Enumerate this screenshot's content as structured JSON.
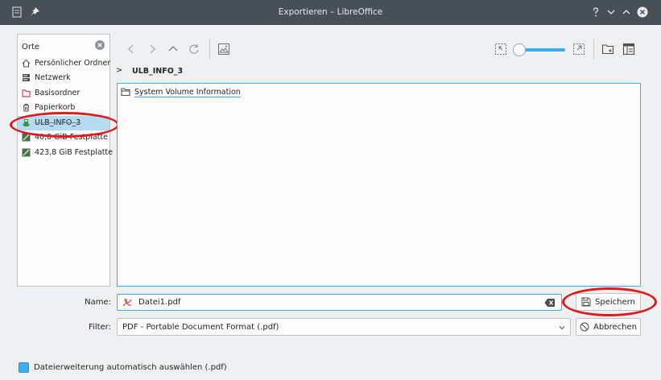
{
  "window": {
    "title": "Exportieren – LibreOffice"
  },
  "places": {
    "header": "Orte",
    "items": [
      {
        "label": "Persönlicher Ordner",
        "icon": "home-icon"
      },
      {
        "label": "Netzwerk",
        "icon": "network-icon"
      },
      {
        "label": "Basisordner",
        "icon": "folder-red-icon"
      },
      {
        "label": "Papierkorb",
        "icon": "trash-icon"
      },
      {
        "label": "ULB_INFO_3",
        "icon": "usb-drive-icon",
        "selected": true
      },
      {
        "label": "40,0 GiB Festplatte",
        "icon": "harddisk-icon"
      },
      {
        "label": "423,8 GiB Festplatte",
        "icon": "harddisk-icon"
      }
    ]
  },
  "breadcrumb": {
    "current": "ULB_INFO_3"
  },
  "files": [
    {
      "label": "System Volume Information",
      "icon": "folder-icon"
    }
  ],
  "form": {
    "name_label": "Name:",
    "name_value": "Datei1.pdf",
    "filter_label": "Filter:",
    "filter_value": "PDF - Portable Document Format (.pdf)"
  },
  "buttons": {
    "save": "Speichern",
    "cancel": "Abbrechen"
  },
  "options": {
    "auto_extension_label": "Dateierweiterung automatisch auswählen (.pdf)",
    "auto_extension_checked": true
  },
  "colors": {
    "accent": "#3daee9",
    "titlebar": "#475057",
    "annotation_red": "#e0191b",
    "pdf_red": "#da4453"
  }
}
